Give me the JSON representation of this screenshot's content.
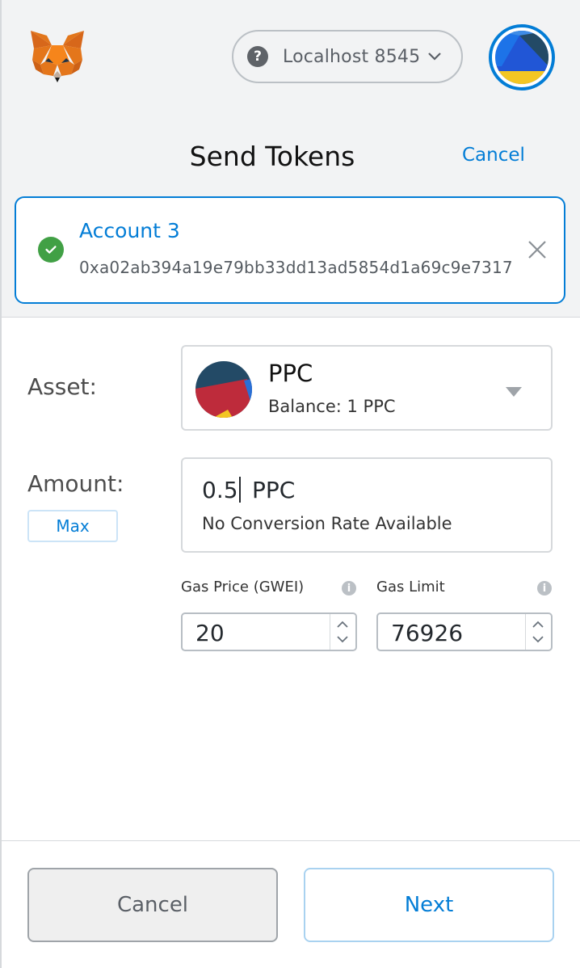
{
  "header": {
    "network_label": "Localhost 8545",
    "help_glyph": "?"
  },
  "page": {
    "title": "Send Tokens",
    "cancel_link": "Cancel"
  },
  "recipient": {
    "name": "Account 3",
    "address": "0xa02ab394a19e79bb33dd13ad5854d1a69c9e7317"
  },
  "asset": {
    "label": "Asset:",
    "symbol": "PPC",
    "balance": "Balance: 1 PPC"
  },
  "amount": {
    "label": "Amount:",
    "value": "0.5",
    "unit": "PPC",
    "conversion_note": "No Conversion Rate Available",
    "max_label": "Max"
  },
  "gas": {
    "price_label": "Gas Price (GWEI)",
    "price_value": "20",
    "limit_label": "Gas Limit",
    "limit_value": "76926",
    "info_glyph": "i"
  },
  "footer": {
    "cancel_label": "Cancel",
    "next_label": "Next"
  },
  "colors": {
    "accent": "#037dd6",
    "success": "#41a045",
    "header_bg": "#f2f3f4"
  },
  "icons": [
    "metamask-fox-icon",
    "help-icon",
    "chevron-down-icon",
    "account-identicon",
    "check-circle-icon",
    "close-icon",
    "token-identicon",
    "dropdown-caret-icon",
    "info-icon",
    "stepper-up-icon",
    "stepper-down-icon"
  ]
}
